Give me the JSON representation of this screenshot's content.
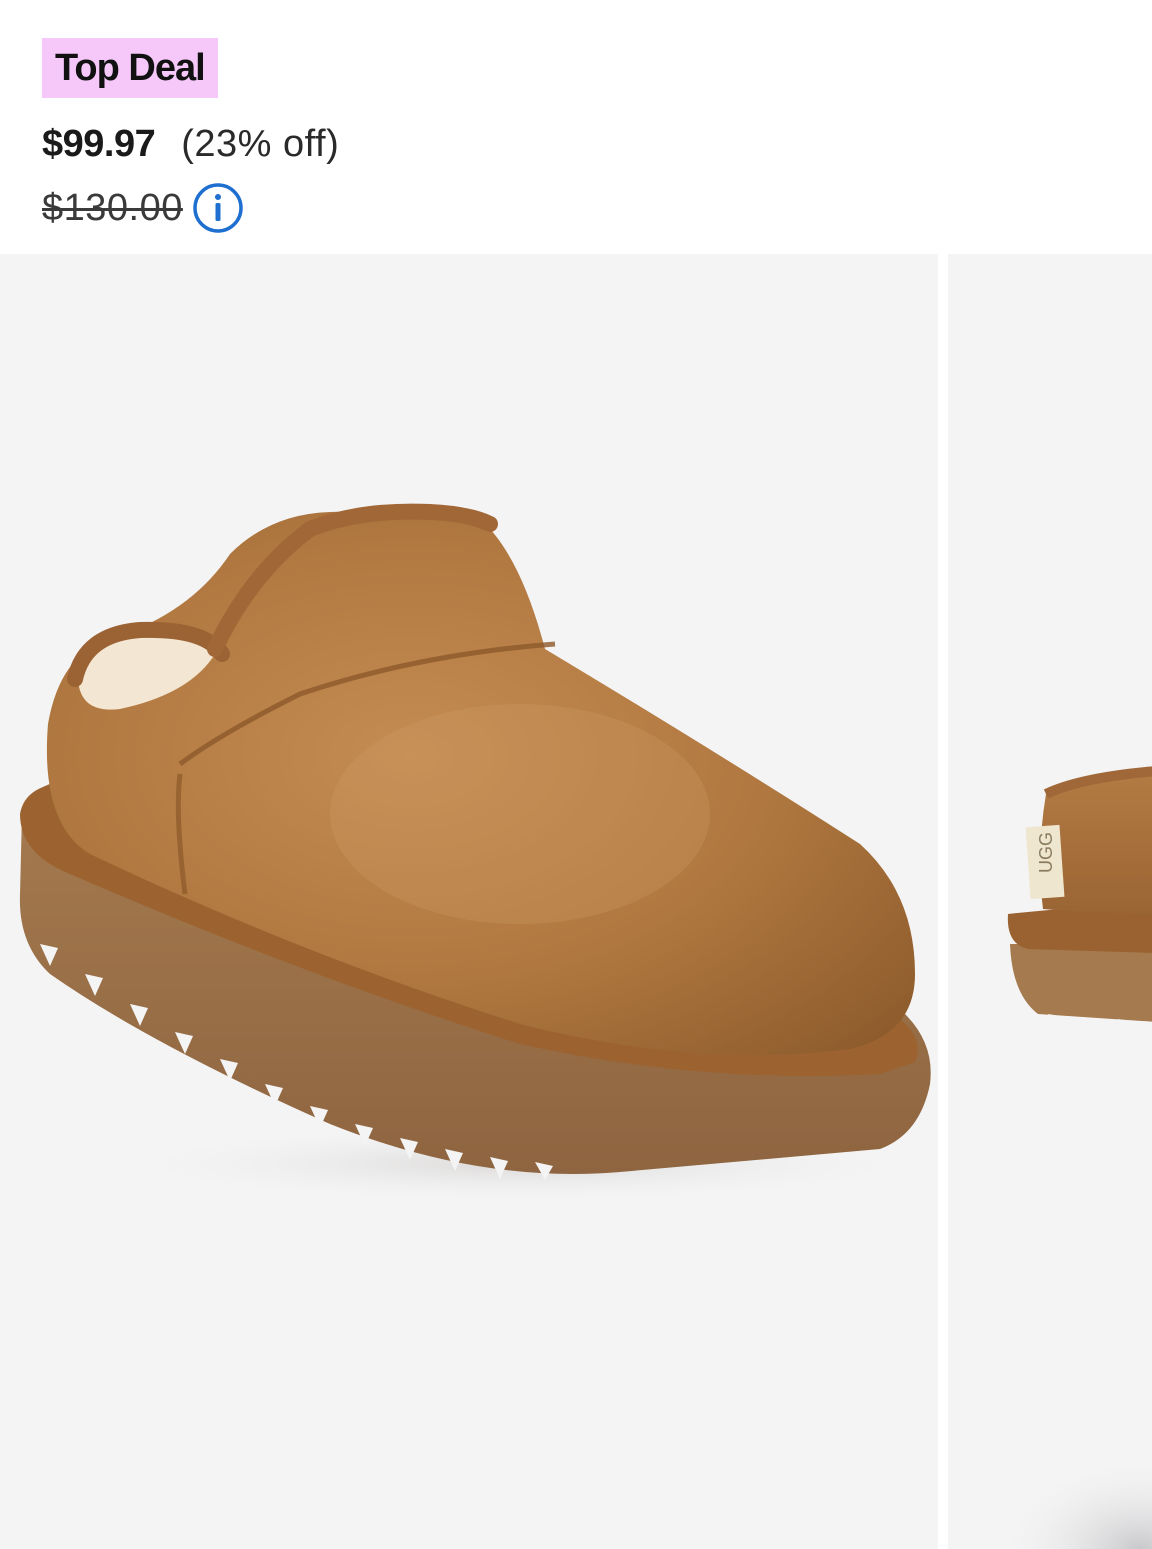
{
  "deal": {
    "badge_label": "Top Deal",
    "badge_color": "#f6c8fa"
  },
  "pricing": {
    "sale_price": "$99.97",
    "discount": "(23% off)",
    "original_price": "$130.00",
    "info_icon": "info-circle-icon",
    "info_icon_color": "#1f6fd1"
  },
  "gallery": {
    "images": [
      {
        "alt": "Chestnut suede slipper, three-quarter front view"
      },
      {
        "alt": "Chestnut suede slipper, rear view"
      }
    ],
    "next_image_tag_text": "UGG"
  },
  "colors": {
    "suede": "#b27a42",
    "sole": "#a1764c",
    "background": "#f4f4f5"
  }
}
